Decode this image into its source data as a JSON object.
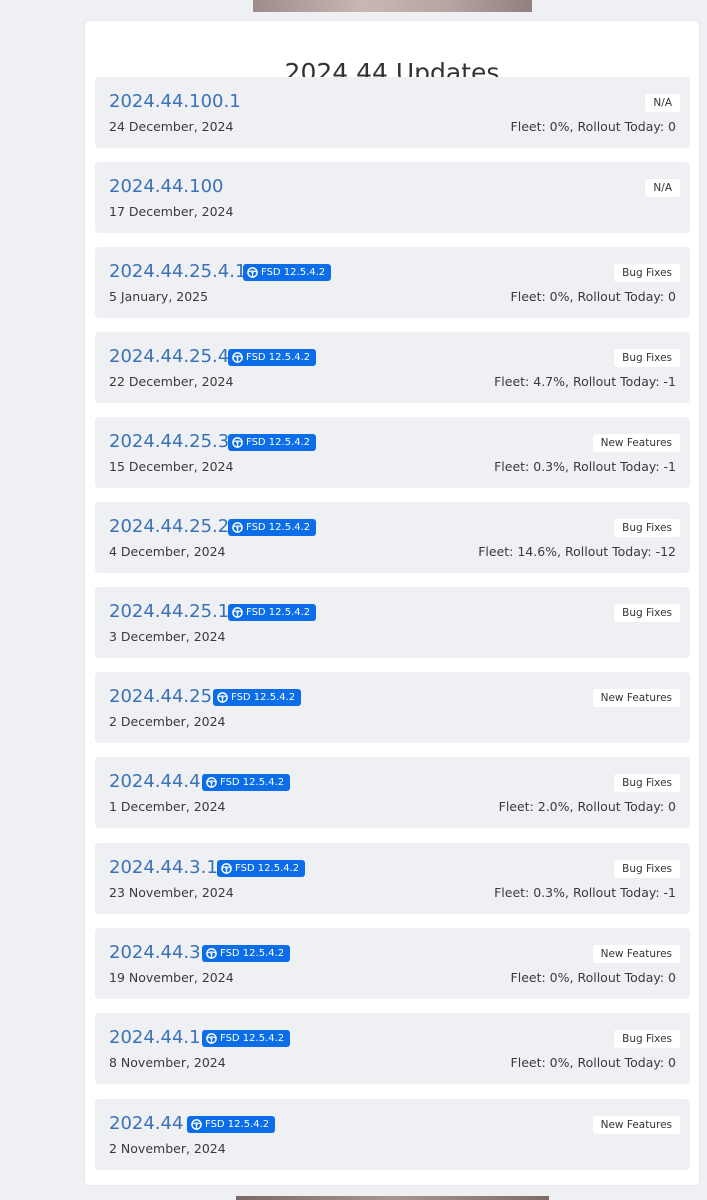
{
  "page_title": "2024.44 Updates",
  "colors": {
    "link": "#3b72b6",
    "fsd_badge": "#0b6de8",
    "card_bg": "#eef0f4",
    "page_bg": "#eef0f4"
  },
  "updates": [
    {
      "version": "2024.44.100.1",
      "date": "24 December, 2024",
      "type": "N/A",
      "fsd": "",
      "fleet": "Fleet: 0%, Rollout Today: 0"
    },
    {
      "version": "2024.44.100",
      "date": "17 December, 2024",
      "type": "N/A",
      "fsd": "",
      "fleet": ""
    },
    {
      "version": "2024.44.25.4.1",
      "date": "5 January, 2025",
      "type": "Bug Fixes",
      "fsd": "FSD 12.5.4.2",
      "fleet": "Fleet: 0%, Rollout Today: 0"
    },
    {
      "version": "2024.44.25.4",
      "date": "22 December, 2024",
      "type": "Bug Fixes",
      "fsd": "FSD 12.5.4.2",
      "fleet": "Fleet: 4.7%, Rollout Today: -1"
    },
    {
      "version": "2024.44.25.3",
      "date": "15 December, 2024",
      "type": "New Features",
      "fsd": "FSD 12.5.4.2",
      "fleet": "Fleet: 0.3%, Rollout Today: -1"
    },
    {
      "version": "2024.44.25.2",
      "date": "4 December, 2024",
      "type": "Bug Fixes",
      "fsd": "FSD 12.5.4.2",
      "fleet": "Fleet: 14.6%, Rollout Today: -12"
    },
    {
      "version": "2024.44.25.1",
      "date": "3 December, 2024",
      "type": "Bug Fixes",
      "fsd": "FSD 12.5.4.2",
      "fleet": ""
    },
    {
      "version": "2024.44.25",
      "date": "2 December, 2024",
      "type": "New Features",
      "fsd": "FSD 12.5.4.2",
      "fleet": ""
    },
    {
      "version": "2024.44.4",
      "date": "1 December, 2024",
      "type": "Bug Fixes",
      "fsd": "FSD 12.5.4.2",
      "fleet": "Fleet: 2.0%, Rollout Today: 0"
    },
    {
      "version": "2024.44.3.1",
      "date": "23 November, 2024",
      "type": "Bug Fixes",
      "fsd": "FSD 12.5.4.2",
      "fleet": "Fleet: 0.3%, Rollout Today: -1"
    },
    {
      "version": "2024.44.3",
      "date": "19 November, 2024",
      "type": "New Features",
      "fsd": "FSD 12.5.4.2",
      "fleet": "Fleet: 0%, Rollout Today: 0"
    },
    {
      "version": "2024.44.1",
      "date": "8 November, 2024",
      "type": "Bug Fixes",
      "fsd": "FSD 12.5.4.2",
      "fleet": "Fleet: 0%, Rollout Today: 0"
    },
    {
      "version": "2024.44",
      "date": "2 November, 2024",
      "type": "New Features",
      "fsd": "FSD 12.5.4.2",
      "fleet": ""
    }
  ]
}
